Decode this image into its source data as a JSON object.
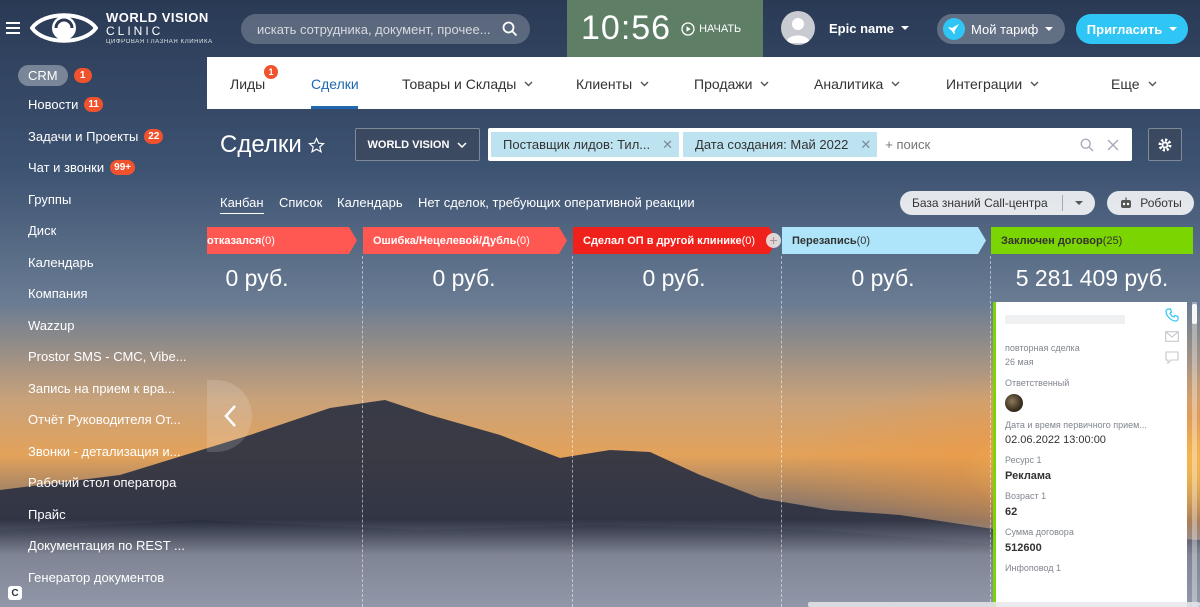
{
  "header": {
    "logo": {
      "line1": "WORLD VISION",
      "line2": "CLINIC",
      "line3": "ЦИФРОВАЯ ГЛАЗНАЯ КЛИНИКА"
    },
    "search_placeholder": "искать сотрудника, документ, прочее...",
    "clock": "10:56",
    "start_label": "НАЧАТЬ",
    "user_name": "Epic name",
    "tariff_label": "Мой тариф",
    "invite_label": "Пригласить"
  },
  "sidebar": {
    "crm": {
      "label": "CRM",
      "badge": "1"
    },
    "items": [
      {
        "label": "Новости",
        "badge": "11"
      },
      {
        "label": "Задачи и Проекты",
        "badge": "22"
      },
      {
        "label": "Чат и звонки",
        "badge": "99+"
      },
      {
        "label": "Группы"
      },
      {
        "label": "Диск"
      },
      {
        "label": "Календарь"
      },
      {
        "label": "Компания"
      },
      {
        "label": "Wazzup"
      },
      {
        "label": "Prostor SMS - СМС, Vibe..."
      },
      {
        "label": "Запись на прием к вра..."
      },
      {
        "label": "Отчёт Руководителя От..."
      },
      {
        "label": "Звонки - детализация и..."
      },
      {
        "label": "Рабочий стол оператора"
      },
      {
        "label": "Прайс"
      },
      {
        "label": "Документация по REST ..."
      },
      {
        "label": "Генератор документов"
      }
    ],
    "bottom_icon": "C"
  },
  "nav": {
    "leads": {
      "label": "Лиды",
      "badge": "1"
    },
    "deals": "Сделки",
    "goods": "Товары и Склады",
    "clients": "Клиенты",
    "sales": "Продажи",
    "analytics": "Аналитика",
    "integrations": "Интеграции",
    "more": "Еще"
  },
  "page": {
    "title": "Сделки",
    "category_button": "WORLD VISION",
    "filter_chips": [
      "Поставщик лидов: Тил...",
      "Дата создания: Май 2022"
    ],
    "filter_placeholder": "+ поиск"
  },
  "views": {
    "kanban": "Канбан",
    "list": "Список",
    "calendar": "Календарь",
    "no_urgent": "Нет сделок, требующих оперативной реакции",
    "knowledge_base": "База знаний Call-центра",
    "robots": "Роботы"
  },
  "columns": [
    {
      "title": "отказался",
      "count": "(0)",
      "sum": "0 руб.",
      "color": "#ff5752"
    },
    {
      "title": "Ошибка/Нецелевой/Дубль",
      "count": "(0)",
      "sum": "0 руб.",
      "color": "#ff5752"
    },
    {
      "title": "Сделал ОП в другой клинике",
      "count": "(0)",
      "sum": "0 руб.",
      "color": "#f0211b"
    },
    {
      "title": "Перезапись",
      "count": "(0)",
      "sum": "0 руб.",
      "color": "#aee5fa"
    },
    {
      "title": "Заключен договор",
      "count": "(25)",
      "sum": "5 281 409 руб.",
      "color": "#7bd500"
    }
  ],
  "deal_card": {
    "subtitle": "повторная сделка",
    "date": "26 мая",
    "responsible_label": "Ответственный",
    "appointment_label": "Дата и время первичного прием...",
    "appointment_value": "02.06.2022 13:00:00",
    "resource_label": "Ресурс 1",
    "resource_value": "Реклама",
    "age_label": "Возраст 1",
    "age_value": "62",
    "contract_label": "Сумма договора",
    "contract_value": "512600",
    "info_label": "Инфоповод 1"
  },
  "colors": {
    "accent": "#2fc6f6",
    "nav_active": "#2067b0",
    "badge": "#f0522d",
    "clock_bg": "#5e7e66"
  }
}
